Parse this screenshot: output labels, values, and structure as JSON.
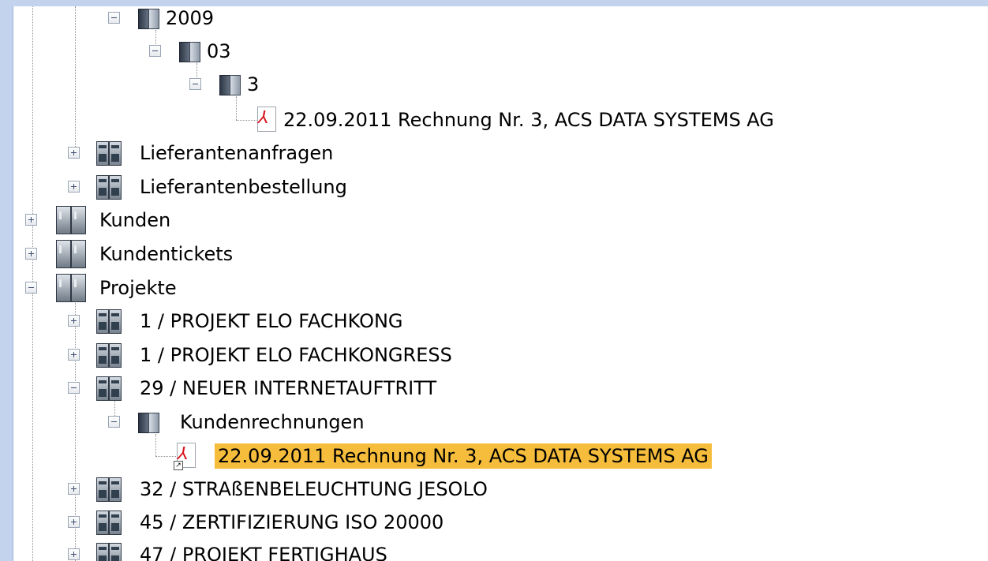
{
  "tree": {
    "n2009": {
      "label": "2009"
    },
    "n03": {
      "label": "03"
    },
    "n3": {
      "label": "3"
    },
    "doc1": {
      "label": "22.09.2011  Rechnung Nr. 3, ACS DATA SYSTEMS AG"
    },
    "lieferantenanfragen": {
      "label": "Lieferantenanfragen"
    },
    "lieferantenbestellung": {
      "label": "Lieferantenbestellung"
    },
    "kunden": {
      "label": "Kunden"
    },
    "kundentickets": {
      "label": "Kundentickets"
    },
    "projekte": {
      "label": "Projekte"
    },
    "p1a": {
      "label": "1 / PROJEKT ELO FACHKONG"
    },
    "p1b": {
      "label": "1 / PROJEKT ELO FACHKONGRESS"
    },
    "p29": {
      "label": "29 / NEUER INTERNETAUFTRITT"
    },
    "kundenrechnungen": {
      "label": "Kundenrechnungen"
    },
    "doc2": {
      "label": "22.09.2011  Rechnung Nr. 3, ACS DATA SYSTEMS AG"
    },
    "p32": {
      "label": "32 / STRAßENBELEUCHTUNG JESOLO"
    },
    "p45": {
      "label": "45 / ZERTIFIZIERUNG ISO 20000"
    },
    "p47": {
      "label": "47 / PROJEKT FERTIGHAUS"
    }
  },
  "colors": {
    "selection": "#f5bd3b",
    "frame": "#c3d3ee",
    "pdf_red": "#d8141b"
  },
  "icons": {
    "folder": "folder-icon",
    "cabinet": "cabinet-icon",
    "pdf": "pdf-document-icon"
  }
}
